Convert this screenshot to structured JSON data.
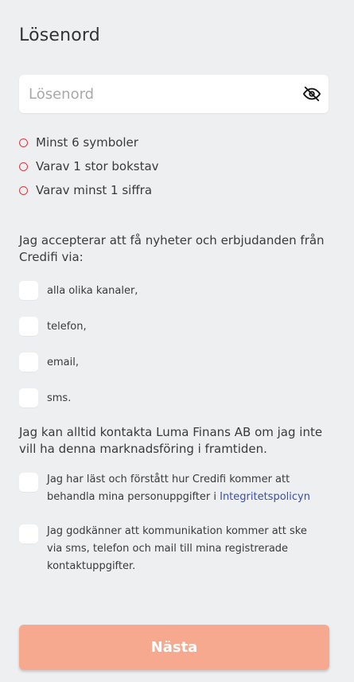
{
  "header": {
    "title": "Lösenord"
  },
  "password": {
    "placeholder": "Lösenord",
    "value": "",
    "toggle_icon": "eye-slash-icon"
  },
  "rules": [
    "Minst 6 symboler",
    "Varav 1 stor bokstav",
    "Varav minst 1 siffra"
  ],
  "marketing": {
    "intro": "Jag accepterar att få nyheter och erbjudanden från Credifi via:",
    "channels": [
      {
        "label": "alla olika kanaler,",
        "checked": false
      },
      {
        "label": "telefon,",
        "checked": false
      },
      {
        "label": "email,",
        "checked": false
      },
      {
        "label": "sms.",
        "checked": false
      }
    ],
    "notice": "Jag kan alltid kontakta Luma Finans AB om jag inte vill ha denna marknadsföring i framtiden."
  },
  "agreements": {
    "privacy": {
      "text": "Jag har läst och förstått hur Credifi kommer att behandla mina personuppgifter i ",
      "link_label": "Integritetspolicyn",
      "checked": false
    },
    "communication": {
      "text": "Jag godkänner att kommunikation kommer att ske via sms, telefon och mail till mina registrerade kontaktuppgifter.",
      "checked": false
    }
  },
  "actions": {
    "next_label": "Nästa"
  },
  "colors": {
    "background": "#eeeff1",
    "accent_button": "#f6a98e",
    "rule_indicator": "#e0393e",
    "link": "#3a4fa8"
  }
}
